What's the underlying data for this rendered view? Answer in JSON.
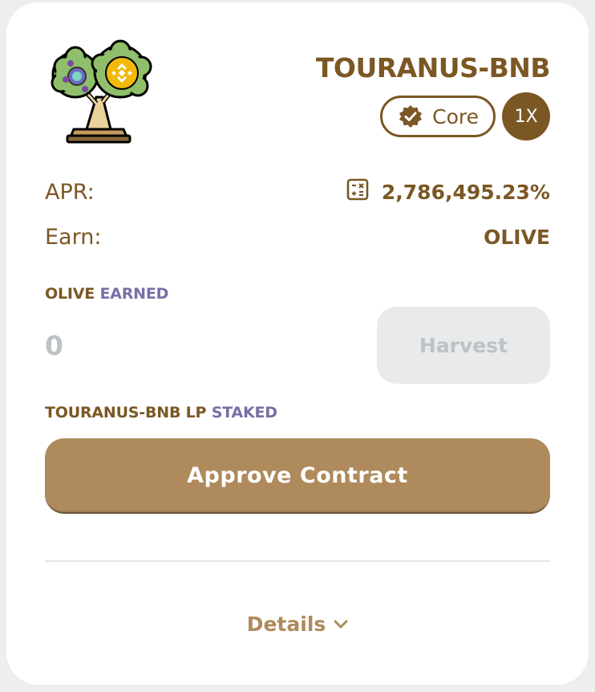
{
  "farm": {
    "title": "TOURANUS-BNB",
    "core_badge": "Core",
    "multiplier": "1X",
    "icon": "olive-tree-bnb-logo"
  },
  "stats": {
    "apr_label": "APR:",
    "apr_value": "2,786,495.23%",
    "apr_icon": "calculator-icon",
    "earn_label": "Earn:",
    "earn_value": "OLIVE"
  },
  "earned": {
    "token": "OLIVE",
    "suffix": "EARNED",
    "amount": "0",
    "harvest_label": "Harvest"
  },
  "staked": {
    "token": "TOURANUS-BNB LP",
    "suffix": "STAKED",
    "approve_label": "Approve Contract"
  },
  "details": {
    "label": "Details",
    "icon": "chevron-down-icon"
  },
  "colors": {
    "brown": "#7b5724",
    "purple": "#7a6ea7",
    "button": "#ae8a5c",
    "disabled": "#bdc2c4"
  }
}
